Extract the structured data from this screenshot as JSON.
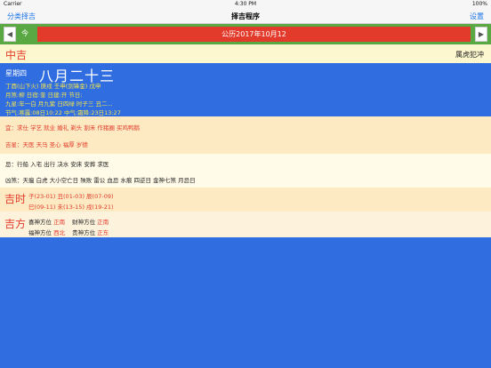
{
  "status_bar": {
    "carrier": "Carrier",
    "time": "4:30 PM",
    "battery": "100%"
  },
  "nav": {
    "left": "分类择吉",
    "title": "择吉程序",
    "right": "设置"
  },
  "date_bar": {
    "prev_icon": "◀",
    "today_label": "今",
    "date": "公历2017年10月12",
    "next_icon": "▶"
  },
  "rating": {
    "level": "中吉",
    "conflict": "属虎犯冲"
  },
  "lunar": {
    "weekday": "星期四",
    "date": "八月二十三",
    "line1": "丁酉(山下火) 庚戌 壬申(剑锋金) 戊申",
    "line2": "月煞:柳 日宿:奎 日建:开  节日:",
    "line3": "九星:年一白 月九紫 日四绿 时子三 丑二...",
    "line4": "节气:寒露:08日10:22 中气:霜降:23日13:27"
  },
  "yi": "宜：求仕 学艺 就业 婚礼 剃头 割禾 作猪圈 买鸡鸭鹅",
  "jixing": "吉星：天医 天马 圣心 福厚 岁德",
  "ji": "忌：行船 入宅 出行 决水 安床 安葬 求医",
  "xiongsha": "凶煞：天瘟 白虎 大小空亡日 殃败 雷公 血忌 水痕 四逆日 金神七煞 月忌日",
  "jishi": {
    "title": "吉时",
    "row1": "子(23-01) 丑(01-03) 辰(07-09)",
    "row2": "巳(09-11) 未(13-15) 戌(19-21)"
  },
  "jifang": {
    "title": "吉方",
    "xi_label": "喜神方位",
    "xi_value": "正南",
    "cai_label": "财神方位",
    "cai_value": "正南",
    "fu_label": "福神方位",
    "fu_value": "西北",
    "gui_label": "贵神方位",
    "gui_value": "正东"
  }
}
